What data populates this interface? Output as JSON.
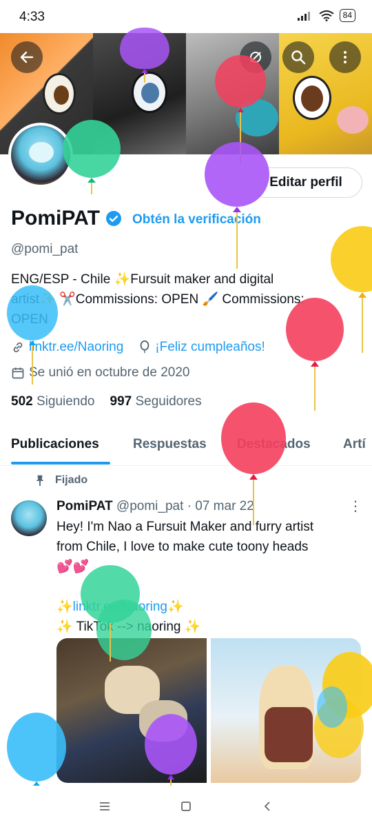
{
  "status_bar": {
    "time": "4:33",
    "battery": "84"
  },
  "profile": {
    "display_name": "PomiPAT",
    "verify_cta": "Obtén la verificación",
    "handle": "@pomi_pat",
    "edit_button": "Editar perfil",
    "bio_line1": "ENG/ESP - Chile  ✨Fursuit maker and digital",
    "bio_line2": "artist✨  ✂️Commissions: OPEN  🖌️ Commissions:",
    "bio_line3": "OPEN",
    "link": "linktr.ee/Naoring",
    "birthday": "¡Feliz cumpleaños!",
    "joined": "Se unió en octubre de 2020",
    "following_count": "502",
    "following_label": "Siguiendo",
    "followers_count": "997",
    "followers_label": "Seguidores"
  },
  "tabs": [
    "Publicaciones",
    "Respuestas",
    "Destacados",
    "Artí"
  ],
  "pinned_tweet": {
    "pinned_label": "Fijado",
    "name": "PomiPAT",
    "handle_date": "@pomi_pat · 07 mar 22",
    "line1": "Hey! I'm Nao a Fursuit Maker and furry artist",
    "line2": "from Chile, I love to make cute toony heads",
    "line3": "💕💕",
    "line5": "✨linktr.ee/Naoring✨",
    "line6": "✨ TikTok --> naoring ✨"
  },
  "icons": {
    "back": "back-arrow-icon",
    "eye_slash": "eye-slash-icon",
    "search": "search-icon",
    "more": "more-vertical-icon",
    "verified": "verified-badge-icon",
    "link": "link-icon",
    "balloon": "balloon-icon",
    "calendar": "calendar-icon",
    "pin": "pin-icon"
  },
  "colors": {
    "accent": "#1d9bf0",
    "text": "#0f1419",
    "secondary": "#536471"
  }
}
